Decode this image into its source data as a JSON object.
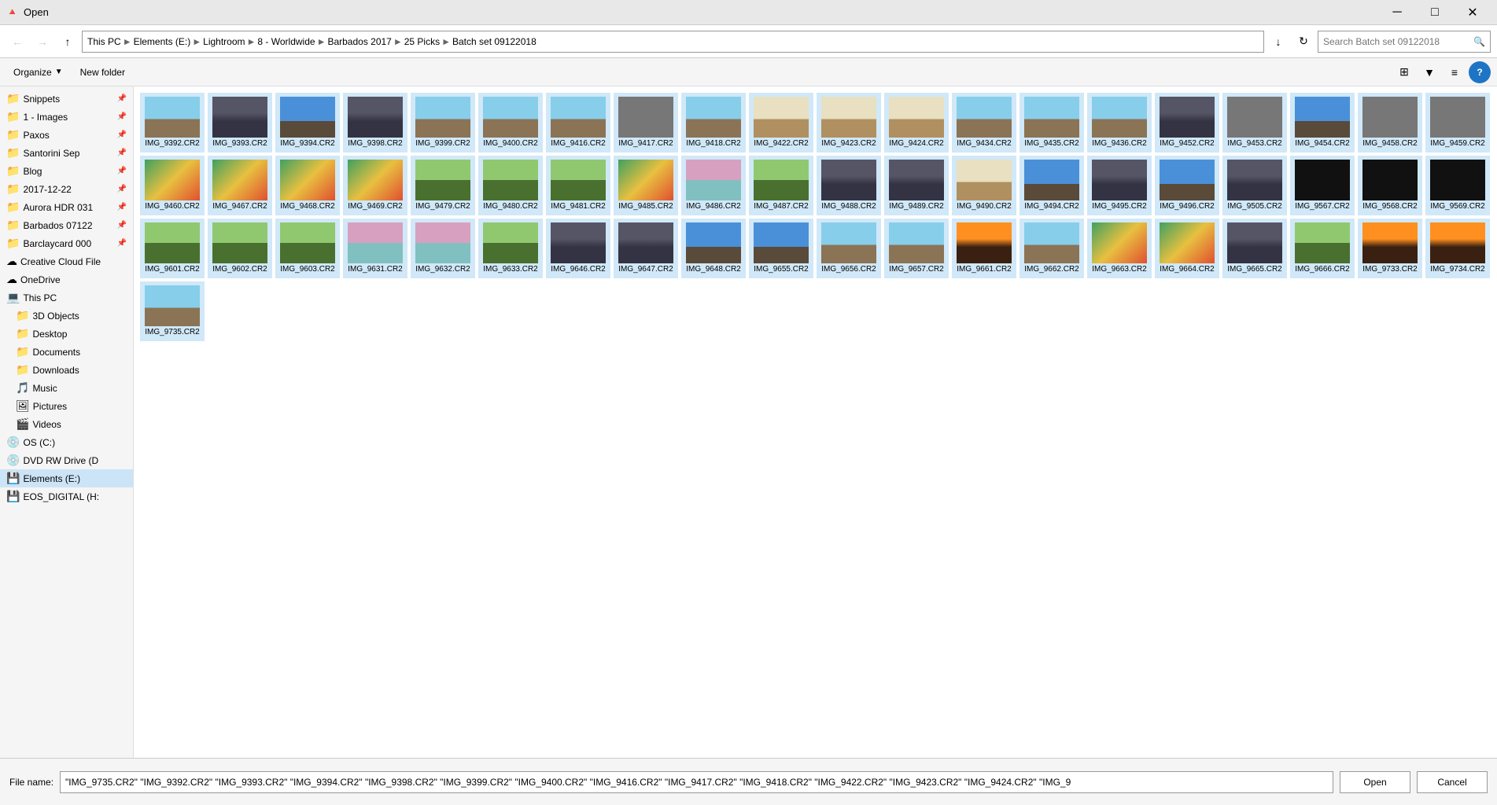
{
  "titleBar": {
    "title": "Open",
    "closeLabel": "✕",
    "minimizeLabel": "─",
    "maximizeLabel": "□"
  },
  "addressBar": {
    "back": "←",
    "forward": "→",
    "up": "↑",
    "breadcrumbs": [
      "This PC",
      "Elements (E:)",
      "Lightroom",
      "8 - Worldwide",
      "Barbados 2017",
      "25 Picks",
      "Batch set 09122018"
    ],
    "searchPlaceholder": "Search Batch set 09122018",
    "refresh": "↻"
  },
  "toolbar": {
    "organize": "Organize",
    "newFolder": "New folder",
    "viewLabel": "⊞",
    "detailsLabel": "≡",
    "helpLabel": "?"
  },
  "sidebar": {
    "items": [
      {
        "label": "Snippets",
        "icon": "📁",
        "pinned": true
      },
      {
        "label": "1 - Images",
        "icon": "📁",
        "pinned": true
      },
      {
        "label": "Paxos",
        "icon": "📁",
        "pinned": true
      },
      {
        "label": "Santorini Sep",
        "icon": "📁",
        "pinned": true
      },
      {
        "label": "Blog",
        "icon": "📁",
        "pinned": true
      },
      {
        "label": "2017-12-22",
        "icon": "📁",
        "pinned": true
      },
      {
        "label": "Aurora HDR 031",
        "icon": "📁",
        "pinned": true
      },
      {
        "label": "Barbados 07122",
        "icon": "📁",
        "pinned": true
      },
      {
        "label": "Barclaycard 000",
        "icon": "📁",
        "pinned": true
      },
      {
        "label": "Creative Cloud File",
        "icon": "☁",
        "pinned": false
      },
      {
        "label": "OneDrive",
        "icon": "☁",
        "pinned": false
      },
      {
        "label": "This PC",
        "icon": "💻",
        "pinned": false
      },
      {
        "label": "3D Objects",
        "icon": "📁",
        "sub": true
      },
      {
        "label": "Desktop",
        "icon": "📁",
        "sub": true
      },
      {
        "label": "Documents",
        "icon": "📁",
        "sub": true
      },
      {
        "label": "Downloads",
        "icon": "📁",
        "sub": true
      },
      {
        "label": "Music",
        "icon": "🎵",
        "sub": true
      },
      {
        "label": "Pictures",
        "icon": "🖼",
        "sub": true
      },
      {
        "label": "Videos",
        "icon": "🎬",
        "sub": true
      },
      {
        "label": "OS (C:)",
        "icon": "💿",
        "sub": false
      },
      {
        "label": "DVD RW Drive (D",
        "icon": "💿",
        "sub": false
      },
      {
        "label": "Elements (E:)",
        "icon": "💾",
        "sub": false,
        "selected": true
      },
      {
        "label": "EOS_DIGITAL (H:",
        "icon": "💾",
        "sub": false
      }
    ]
  },
  "files": [
    {
      "name": "IMG_9392.CR2",
      "thumb": "sky"
    },
    {
      "name": "IMG_9393.CR2",
      "thumb": "dark"
    },
    {
      "name": "IMG_9394.CR2",
      "thumb": "blue"
    },
    {
      "name": "IMG_9398.CR2",
      "thumb": "dark"
    },
    {
      "name": "IMG_9399.CR2",
      "thumb": "sky"
    },
    {
      "name": "IMG_9400.CR2",
      "thumb": "sky"
    },
    {
      "name": "IMG_9416.CR2",
      "thumb": "sky"
    },
    {
      "name": "IMG_9417.CR2",
      "thumb": "gray"
    },
    {
      "name": "IMG_9418.CR2",
      "thumb": "sky"
    },
    {
      "name": "IMG_9422.CR2",
      "thumb": "bright"
    },
    {
      "name": "IMG_9423.CR2",
      "thumb": "bright"
    },
    {
      "name": "IMG_9424.CR2",
      "thumb": "bright"
    },
    {
      "name": "IMG_9434.CR2",
      "thumb": "sky"
    },
    {
      "name": "IMG_9435.CR2",
      "thumb": "sky"
    },
    {
      "name": "IMG_9436.CR2",
      "thumb": "sky"
    },
    {
      "name": "IMG_9452.CR2",
      "thumb": "dark"
    },
    {
      "name": "IMG_9453.CR2",
      "thumb": "gray"
    },
    {
      "name": "IMG_9454.CR2",
      "thumb": "blue"
    },
    {
      "name": "IMG_9458.CR2",
      "thumb": "gray"
    },
    {
      "name": "IMG_9459.CR2",
      "thumb": "gray"
    },
    {
      "name": "IMG_9460.CR2",
      "thumb": "colorful"
    },
    {
      "name": "IMG_9467.CR2",
      "thumb": "colorful"
    },
    {
      "name": "IMG_9468.CR2",
      "thumb": "colorful"
    },
    {
      "name": "IMG_9469.CR2",
      "thumb": "colorful"
    },
    {
      "name": "IMG_9479.CR2",
      "thumb": "green"
    },
    {
      "name": "IMG_9480.CR2",
      "thumb": "green"
    },
    {
      "name": "IMG_9481.CR2",
      "thumb": "green"
    },
    {
      "name": "IMG_9485.CR2",
      "thumb": "colorful"
    },
    {
      "name": "IMG_9486.CR2",
      "thumb": "pink"
    },
    {
      "name": "IMG_9487.CR2",
      "thumb": "green"
    },
    {
      "name": "IMG_9488.CR2",
      "thumb": "dark"
    },
    {
      "name": "IMG_9489.CR2",
      "thumb": "dark"
    },
    {
      "name": "IMG_9490.CR2",
      "thumb": "bright"
    },
    {
      "name": "IMG_9494.CR2",
      "thumb": "blue"
    },
    {
      "name": "IMG_9495.CR2",
      "thumb": "dark"
    },
    {
      "name": "IMG_9496.CR2",
      "thumb": "blue"
    },
    {
      "name": "IMG_9505.CR2",
      "thumb": "dark"
    },
    {
      "name": "IMG_9567.CR2",
      "thumb": "dark2"
    },
    {
      "name": "IMG_9568.CR2",
      "thumb": "dark2"
    },
    {
      "name": "IMG_9569.CR2",
      "thumb": "dark2"
    },
    {
      "name": "IMG_9601.CR2",
      "thumb": "green"
    },
    {
      "name": "IMG_9602.CR2",
      "thumb": "green"
    },
    {
      "name": "IMG_9603.CR2",
      "thumb": "green"
    },
    {
      "name": "IMG_9631.CR2",
      "thumb": "pink"
    },
    {
      "name": "IMG_9632.CR2",
      "thumb": "pink"
    },
    {
      "name": "IMG_9633.CR2",
      "thumb": "green"
    },
    {
      "name": "IMG_9646.CR2",
      "thumb": "dark"
    },
    {
      "name": "IMG_9647.CR2",
      "thumb": "dark"
    },
    {
      "name": "IMG_9648.CR2",
      "thumb": "blue"
    },
    {
      "name": "IMG_9655.CR2",
      "thumb": "blue"
    },
    {
      "name": "IMG_9656.CR2",
      "thumb": "sky"
    },
    {
      "name": "IMG_9657.CR2",
      "thumb": "sky"
    },
    {
      "name": "IMG_9661.CR2",
      "thumb": "sunset"
    },
    {
      "name": "IMG_9662.CR2",
      "thumb": "sky"
    },
    {
      "name": "IMG_9663.CR2",
      "thumb": "colorful"
    },
    {
      "name": "IMG_9664.CR2",
      "thumb": "colorful"
    },
    {
      "name": "IMG_9665.CR2",
      "thumb": "dark"
    },
    {
      "name": "IMG_9666.CR2",
      "thumb": "green"
    },
    {
      "name": "IMG_9733.CR2",
      "thumb": "sunset"
    },
    {
      "name": "IMG_9734.CR2",
      "thumb": "sunset"
    },
    {
      "name": "IMG_9735.CR2",
      "thumb": "sky"
    }
  ],
  "bottomBar": {
    "fileLabel": "File name:",
    "fileNameValue": "\"IMG_9735.CR2\" \"IMG_9392.CR2\" \"IMG_9393.CR2\" \"IMG_9394.CR2\" \"IMG_9398.CR2\" \"IMG_9399.CR2\" \"IMG_9400.CR2\" \"IMG_9416.CR2\" \"IMG_9417.CR2\" \"IMG_9418.CR2\" \"IMG_9422.CR2\" \"IMG_9423.CR2\" \"IMG_9424.CR2\" \"IMG_9",
    "openLabel": "Open",
    "cancelLabel": "Cancel"
  }
}
